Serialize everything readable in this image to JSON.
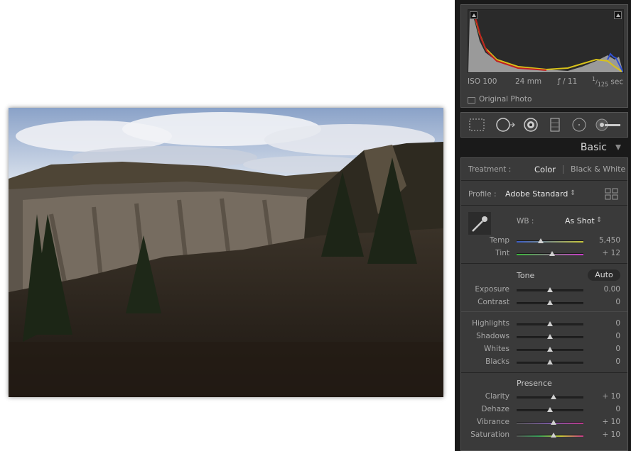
{
  "histogram": {
    "iso": "ISO 100",
    "focal": "24 mm",
    "aperture": "ƒ / 11",
    "shutter_num": "1",
    "shutter_den": "125",
    "shutter_unit": "sec",
    "original_photo": "Original Photo"
  },
  "panel": {
    "title": "Basic"
  },
  "treatment": {
    "label": "Treatment :",
    "color": "Color",
    "bw": "Black & White"
  },
  "profile": {
    "label": "Profile :",
    "value": "Adobe Standard",
    "arrow": "⇕"
  },
  "wb": {
    "label": "WB :",
    "value": "As Shot",
    "arrow": "⇕"
  },
  "sliders": {
    "temp": {
      "label": "Temp",
      "value": "5,450",
      "pos": 0.36
    },
    "tint": {
      "label": "Tint",
      "value": "+ 12",
      "pos": 0.53
    },
    "exposure": {
      "label": "Exposure",
      "value": "0.00",
      "pos": 0.5
    },
    "contrast": {
      "label": "Contrast",
      "value": "0",
      "pos": 0.5
    },
    "highlights": {
      "label": "Highlights",
      "value": "0",
      "pos": 0.5
    },
    "shadows": {
      "label": "Shadows",
      "value": "0",
      "pos": 0.5
    },
    "whites": {
      "label": "Whites",
      "value": "0",
      "pos": 0.5
    },
    "blacks": {
      "label": "Blacks",
      "value": "0",
      "pos": 0.5
    },
    "clarity": {
      "label": "Clarity",
      "value": "+ 10",
      "pos": 0.55
    },
    "dehaze": {
      "label": "Dehaze",
      "value": "0",
      "pos": 0.5
    },
    "vibrance": {
      "label": "Vibrance",
      "value": "+ 10",
      "pos": 0.55
    },
    "saturation": {
      "label": "Saturation",
      "value": "+ 10",
      "pos": 0.55
    }
  },
  "tone": {
    "label": "Tone",
    "auto": "Auto"
  },
  "presence": {
    "label": "Presence"
  },
  "colors": {
    "panel_bg": "#3a3a3a",
    "dark_bg": "#1a1a1a",
    "text": "#a8a8a8",
    "highlight_text": "#e8e8e8"
  }
}
